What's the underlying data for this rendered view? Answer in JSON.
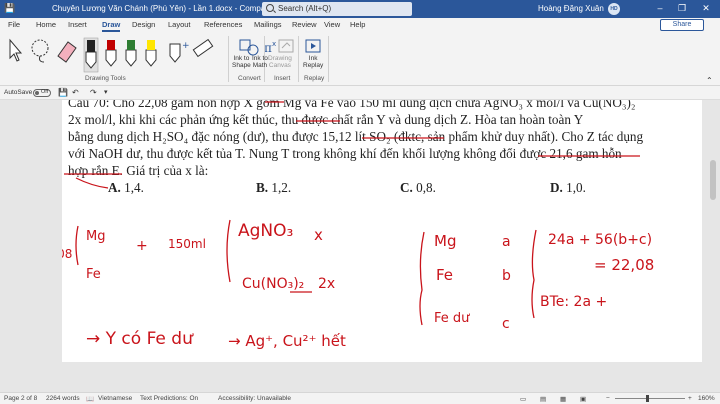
{
  "titlebar": {
    "title": "Chuyên Lương Văn Chánh (Phú Yên) - Lần 1.docx  -  Compati...",
    "search": "Search (Alt+Q)",
    "user": "Hoàng Đặng Xuân",
    "avatar": "HD",
    "minimize": "–",
    "restore": "❐",
    "close": "✕"
  },
  "tabs": [
    "File",
    "Home",
    "Insert",
    "Draw",
    "Design",
    "Layout",
    "References",
    "Mailings",
    "Review",
    "View",
    "Help"
  ],
  "active_tab": "Draw",
  "share_label": "Share",
  "ribbon": {
    "tools_label": "Drawing Tools",
    "convert_label": "Convert",
    "insert_label": "Insert",
    "replay_label": "Replay",
    "ink_to_shape": "Ink to\nShape",
    "ink_to_math": "Ink to\nMath",
    "drawing_canvas": "Drawing\nCanvas",
    "ink_replay": "Ink\nReplay",
    "pen_colors": [
      "#222222",
      "#c00000",
      "#2e7d32",
      "#ffe600"
    ]
  },
  "quick_access": {
    "autosave_label": "AutoSave",
    "autosave_state": "Off"
  },
  "document": {
    "lines": [
      "Câu 70: Cho 22,08 gam hỗn hợp X gồm Mg và Fe vào 150 ml dung dịch chứa AgNO₃ x mol/l và Cu(NO₃)₂",
      "2x mol/l, khi khi các phản ứng kết thúc, thu được chất rắn Y và dung dịch Z. Hòa tan hoàn toàn Y",
      "bằng dung dịch H₂SO₄ đặc nóng (dư), thu được 15,12 lít SO₂ (đktc, sản phẩm khử duy nhất). Cho Z tác dụng",
      "với NaOH dư, thu được kết tủa T. Nung T trong không khí đến khối lượng không đổi được 21,6 gam hỗn",
      "hợp rắn E. Giá trị của x là:"
    ],
    "answers": [
      {
        "letter": "A.",
        "value": "1,4."
      },
      {
        "letter": "B.",
        "value": "1,2."
      },
      {
        "letter": "C.",
        "value": "0,8."
      },
      {
        "letter": "D.",
        "value": "1,0."
      }
    ],
    "handwriting": {
      "mass": "22,08",
      "mg": "Mg",
      "fe": "Fe",
      "plus": "+",
      "vol": "150ml",
      "agno3": "AgNO₃",
      "x": "x",
      "cuno3": "Cu(NO₃)₂",
      "two_x": "2x",
      "y_contains": "→ Y có Fe dư",
      "arrow_ag": "→ Ag⁺, Cu²⁺ hết",
      "mg2": "Mg",
      "a": "a",
      "fe2": "Fe",
      "b": "b",
      "fe_du": "Fe dư",
      "c": "c",
      "eq1": "24a + 56(b+c)",
      "eq2": "= 22,08",
      "bte": "BTe: 2a +"
    }
  },
  "status": {
    "page": "Page 2 of 8",
    "words": "2264 words",
    "language": "Vietnamese",
    "text_predictions": "Text Predictions: On",
    "accessibility": "Accessibility: Unavailable",
    "zoom": "160%"
  },
  "colors": {
    "brand": "#2b579a",
    "ink": "#c9141b"
  }
}
